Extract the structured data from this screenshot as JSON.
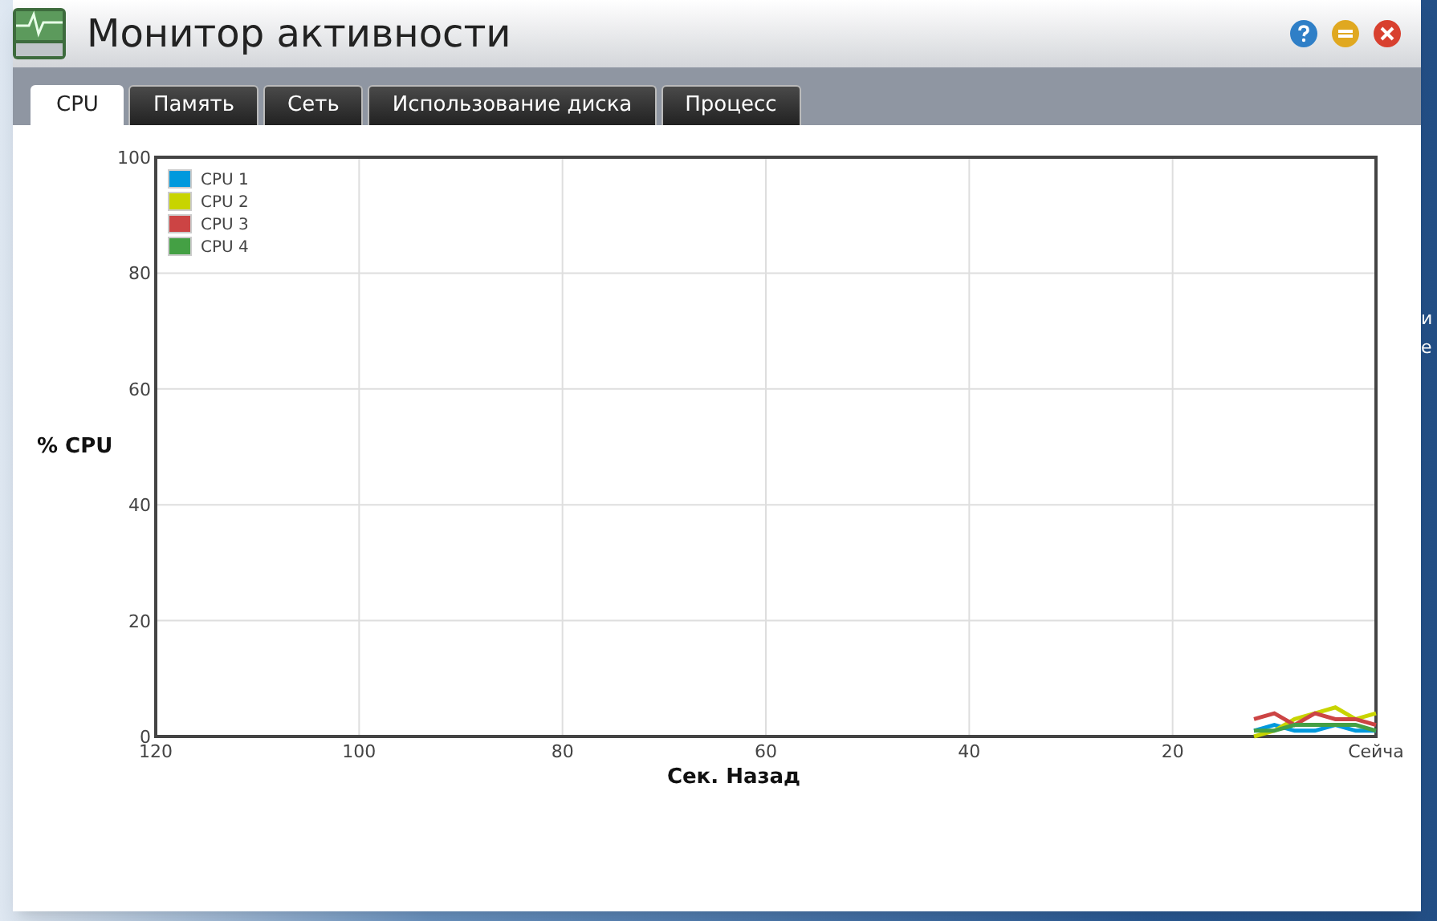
{
  "window": {
    "title": "Монитор активности"
  },
  "tabs": [
    {
      "label": "CPU",
      "selected": true
    },
    {
      "label": "Память",
      "selected": false
    },
    {
      "label": "Сеть",
      "selected": false
    },
    {
      "label": "Использование диска",
      "selected": false
    },
    {
      "label": "Процесс",
      "selected": false
    }
  ],
  "chart": {
    "chart_data": {
      "type": "line",
      "xlabel": "Сек. Назад",
      "ylabel": "% CPU",
      "x": [
        12,
        10,
        8,
        6,
        4,
        2,
        0
      ],
      "xlim": [
        120,
        0
      ],
      "ylim": [
        0,
        100
      ],
      "xticks": [
        120,
        100,
        80,
        60,
        40,
        20,
        {
          "value": 0,
          "label": "Сейча"
        }
      ],
      "yticks": [
        0,
        20,
        40,
        60,
        80,
        100
      ],
      "grid": true,
      "legend": true,
      "series": [
        {
          "name": "CPU 1",
          "color": "#0099dd",
          "values": [
            1,
            2,
            1,
            1,
            2,
            1,
            1
          ]
        },
        {
          "name": "CPU 2",
          "color": "#c8d400",
          "values": [
            0,
            1,
            3,
            4,
            5,
            3,
            4
          ]
        },
        {
          "name": "CPU 3",
          "color": "#cc4444",
          "values": [
            3,
            4,
            2,
            4,
            3,
            3,
            2
          ]
        },
        {
          "name": "CPU 4",
          "color": "#44a044",
          "values": [
            1,
            1,
            2,
            2,
            2,
            2,
            1
          ]
        }
      ]
    }
  },
  "desktop_text": [
    "и",
    "е"
  ]
}
